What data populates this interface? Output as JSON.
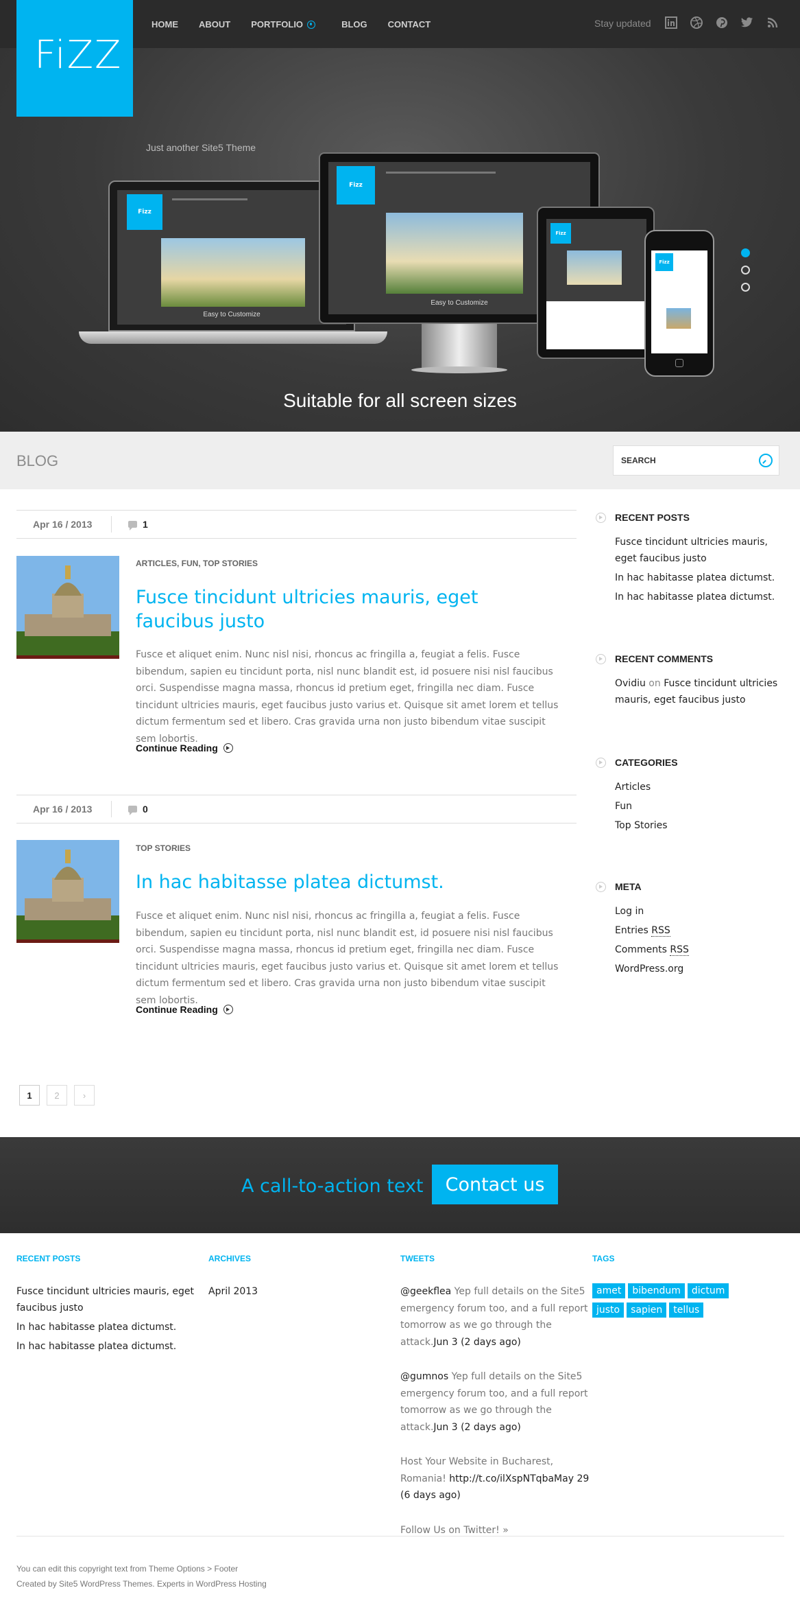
{
  "header": {
    "logo": "FiZZ",
    "tagline": "Just another Site5 Theme",
    "nav": [
      "HOME",
      "ABOUT",
      "PORTFOLIO",
      "BLOG",
      "CONTACT"
    ],
    "stay_updated": "Stay updated",
    "social_icons": [
      "linkedin-icon",
      "dribbble-icon",
      "pinterest-icon",
      "twitter-icon",
      "rss-icon"
    ]
  },
  "hero": {
    "caption": "Suitable for all screen sizes",
    "device_text": "Easy to Customize",
    "mini_logo": "Fizz",
    "slides": 3,
    "active_slide": 1
  },
  "blogbar": {
    "title": "BLOG",
    "search_placeholder": "SEARCH"
  },
  "posts": [
    {
      "date": "Apr 16 / 2013",
      "comments": "1",
      "categories": "ARTICLES, FUN, TOP STORIES",
      "title": "Fusce tincidunt ultricies mauris, eget faucibus justo",
      "excerpt": "Fusce et aliquet enim. Nunc nisl nisi, rhoncus ac fringilla a, feugiat a felis. Fusce bibendum, sapien eu tincidunt porta, nisl nunc blandit est, id posuere nisi nisl faucibus orci. Suspendisse magna massa, rhoncus id pretium eget, fringilla nec diam. Fusce tincidunt ultricies mauris, eget faucibus justo varius et. Quisque sit amet lorem et tellus dictum fermentum sed et libero. Cras gravida urna non justo bibendum vitae suscipit sem lobortis.",
      "more": "Continue Reading"
    },
    {
      "date": "Apr 16 / 2013",
      "comments": "0",
      "categories": "TOP STORIES",
      "title": "In hac habitasse platea dictumst.",
      "excerpt": "Fusce et aliquet enim. Nunc nisl nisi, rhoncus ac fringilla a, feugiat a felis. Fusce bibendum, sapien eu tincidunt porta, nisl nunc blandit est, id posuere nisi nisl faucibus orci. Suspendisse magna massa, rhoncus id pretium eget, fringilla nec diam. Fusce tincidunt ultricies mauris, eget faucibus justo varius et. Quisque sit amet lorem et tellus dictum fermentum sed et libero. Cras gravida urna non justo bibendum vitae suscipit sem lobortis.",
      "more": "Continue Reading"
    }
  ],
  "pagination": [
    "1",
    "2",
    "›"
  ],
  "sidebar": {
    "recent_posts": {
      "title": "RECENT POSTS",
      "items": [
        "Fusce tincidunt ultricies mauris, eget faucibus justo",
        "In hac habitasse platea dictumst.",
        "In hac habitasse platea dictumst."
      ]
    },
    "recent_comments": {
      "title": "RECENT COMMENTS",
      "author": "Ovidiu",
      "on": "on",
      "post": "Fusce tincidunt ultricies mauris, eget faucibus justo"
    },
    "categories": {
      "title": "CATEGORIES",
      "items": [
        "Articles",
        "Fun",
        "Top Stories"
      ]
    },
    "meta": {
      "title": "META",
      "login": "Log in",
      "entries_a": "Entries ",
      "entries_b": "RSS",
      "comments_a": "Comments ",
      "comments_b": "RSS",
      "wp": "WordPress.org"
    }
  },
  "cta": {
    "text": "A call-to-action text",
    "button": "Contact us"
  },
  "footer": {
    "recent_posts": {
      "title": "RECENT POSTS",
      "items": [
        "Fusce tincidunt ultricies mauris, eget faucibus justo",
        "In hac habitasse platea dictumst.",
        "In hac habitasse platea dictumst."
      ]
    },
    "archives": {
      "title": "ARCHIVES",
      "items": [
        "April 2013"
      ]
    },
    "tweets": {
      "title": "TWEETS",
      "t1_user": "@geekflea",
      "t1_text": " Yep full details on the Site5 emergency forum too, and a full report tomorrow as we go through the attack.",
      "t1_time": "Jun 3 (2 days ago)",
      "t2_user": "@gumnos",
      "t2_text": " Yep full details on the Site5 emergency forum too, and a full report tomorrow as we go through the attack.",
      "t2_time": "Jun 3 (2 days ago)",
      "t3_text": "Host Your Website in Bucharest, Romania! ",
      "t3_link": "http://t.co/ilXspNTqba",
      "t3_time": "May 29 (6 days ago)",
      "follow": "Follow Us on Twitter! »"
    },
    "tags": {
      "title": "TAGS",
      "items": [
        "amet",
        "bibendum",
        "dictum",
        "justo",
        "sapien",
        "tellus"
      ]
    },
    "copyright1": "You can edit this copyright text from Theme Options > Footer",
    "copyright2": "Created by Site5 WordPress Themes. Experts in WordPress Hosting"
  },
  "colors": {
    "accent": "#00b4f0",
    "header_bg": "#2b2b2b",
    "hero_bg": "#3a3a3a",
    "blogbar_bg": "#eeeeee"
  }
}
